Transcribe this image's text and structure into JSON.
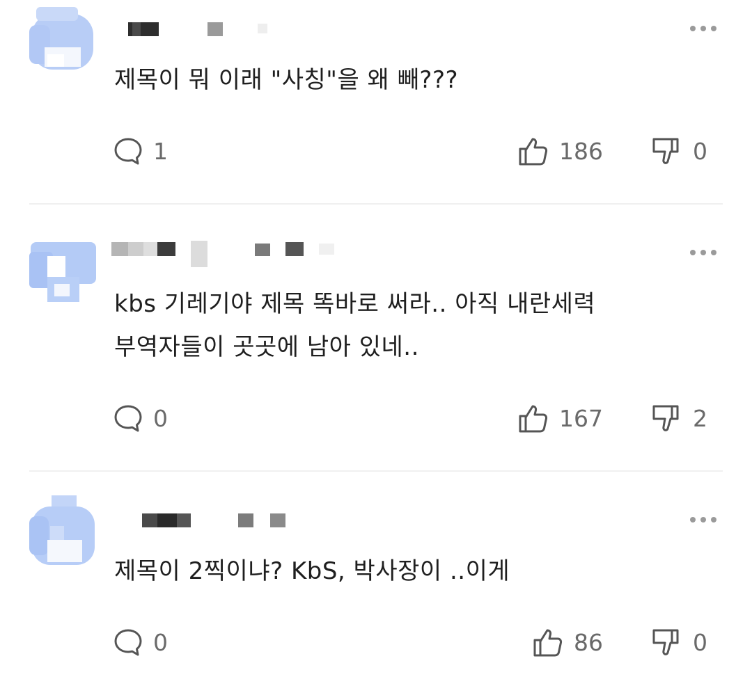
{
  "comments": [
    {
      "text_lines": [
        "제목이 뭐 이래 \"사칭\"을 왜 빼???"
      ],
      "replies": "1",
      "likes": "186",
      "dislikes": "0"
    },
    {
      "text_lines": [
        "kbs 기레기야 제목 똑바로 써라.. 아직 내란세력",
        "부역자들이 곳곳에 남아 있네.."
      ],
      "replies": "0",
      "likes": "167",
      "dislikes": "2"
    },
    {
      "text_lines": [
        "제목이 2찍이냐? KbS, 박사장이 ..이게"
      ],
      "replies": "0",
      "likes": "86",
      "dislikes": "0"
    }
  ],
  "icons": {
    "reply": "speech-bubble-icon",
    "like": "thumbs-up-icon",
    "dislike": "thumbs-down-icon",
    "more": "more-dots-icon"
  },
  "colors": {
    "avatar_blur": "#b7cdf7",
    "divider": "#f0f0f0",
    "count_text": "#6a6a6a"
  }
}
